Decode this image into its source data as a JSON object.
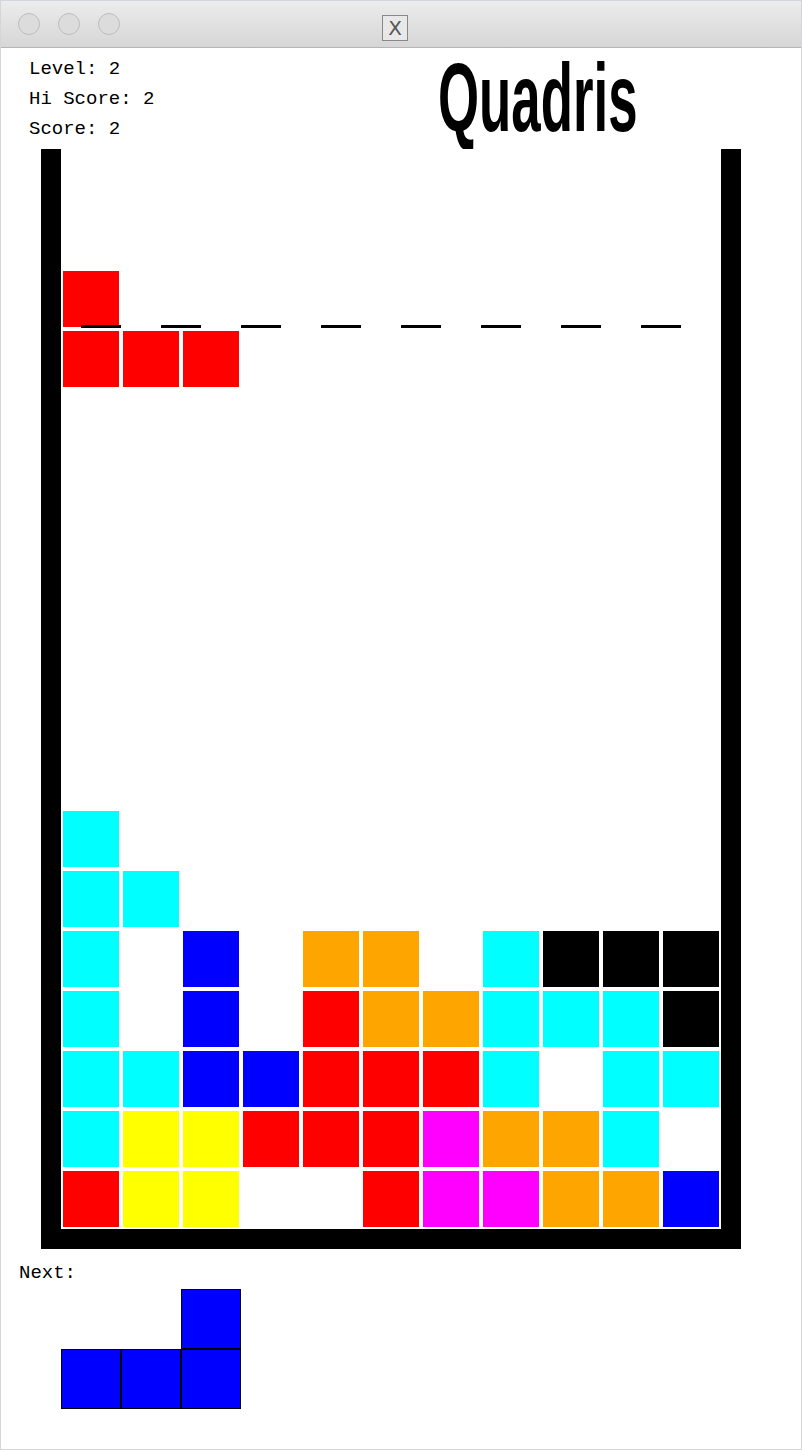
{
  "window": {
    "title_icon": "X"
  },
  "stats": [
    {
      "label": "Level:",
      "value": "2"
    },
    {
      "label": "Hi Score:",
      "value": "2"
    },
    {
      "label": "Score:",
      "value": "2"
    }
  ],
  "logo": "Quadris",
  "board": {
    "rows": [
      [
        "",
        "",
        "",
        "",
        "",
        "",
        "",
        "",
        "",
        "",
        ""
      ],
      [
        "",
        "",
        "",
        "",
        "",
        "",
        "",
        "",
        "",
        "",
        ""
      ],
      [
        "#ff0000",
        "",
        "",
        "",
        "",
        "",
        "",
        "",
        "",
        "",
        ""
      ],
      [
        "#ff0000",
        "#ff0000",
        "#ff0000",
        "",
        "",
        "",
        "",
        "",
        "",
        "",
        ""
      ],
      [
        "",
        "",
        "",
        "",
        "",
        "",
        "",
        "",
        "",
        "",
        ""
      ],
      [
        "",
        "",
        "",
        "",
        "",
        "",
        "",
        "",
        "",
        "",
        ""
      ],
      [
        "",
        "",
        "",
        "",
        "",
        "",
        "",
        "",
        "",
        "",
        ""
      ],
      [
        "",
        "",
        "",
        "",
        "",
        "",
        "",
        "",
        "",
        "",
        ""
      ],
      [
        "",
        "",
        "",
        "",
        "",
        "",
        "",
        "",
        "",
        "",
        ""
      ],
      [
        "",
        "",
        "",
        "",
        "",
        "",
        "",
        "",
        "",
        "",
        ""
      ],
      [
        "",
        "",
        "",
        "",
        "",
        "",
        "",
        "",
        "",
        "",
        ""
      ],
      [
        "#00ffff",
        "",
        "",
        "",
        "",
        "",
        "",
        "",
        "",
        "",
        ""
      ],
      [
        "#00ffff",
        "#00ffff",
        "",
        "",
        "",
        "",
        "",
        "",
        "",
        "",
        ""
      ],
      [
        "#00ffff",
        "",
        "#0000ff",
        "",
        "#ffa500",
        "#ffa500",
        "",
        "#00ffff",
        "#000000",
        "#000000",
        "#000000"
      ],
      [
        "#00ffff",
        "",
        "#0000ff",
        "",
        "#ff0000",
        "#ffa500",
        "#ffa500",
        "#00ffff",
        "#00ffff",
        "#00ffff",
        "#000000"
      ],
      [
        "#00ffff",
        "#00ffff",
        "#0000ff",
        "#0000ff",
        "#ff0000",
        "#ff0000",
        "#ff0000",
        "#00ffff",
        "",
        "#00ffff",
        "#00ffff"
      ],
      [
        "#00ffff",
        "#ffff00",
        "#ffff00",
        "#ff0000",
        "#ff0000",
        "#ff0000",
        "#ff00ff",
        "#ffa500",
        "#ffa500",
        "#00ffff",
        ""
      ],
      [
        "#ff0000",
        "#ffff00",
        "#ffff00",
        "",
        "",
        "#ff0000",
        "#ff00ff",
        "#ff00ff",
        "#ffa500",
        "#ffa500",
        "#0000ff"
      ]
    ]
  },
  "next": {
    "label": "Next:",
    "rows": [
      [
        "",
        "",
        "#0000ff"
      ],
      [
        "#0000ff",
        "#0000ff",
        "#0000ff"
      ]
    ]
  }
}
